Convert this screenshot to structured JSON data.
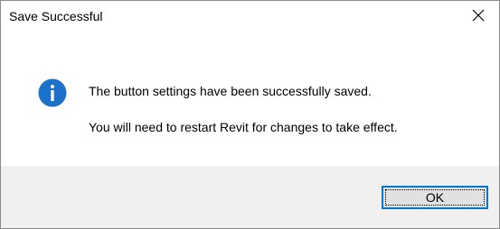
{
  "window": {
    "title": "Save Successful",
    "close_icon": "close-icon"
  },
  "message": {
    "icon": "info-icon",
    "line1": "The button settings have been successfully saved.",
    "line2": "You will need to restart Revit for changes to take effect."
  },
  "buttons": {
    "ok_label": "OK"
  },
  "colors": {
    "accent": "#0078d7",
    "footer_bg": "#f0f0f0",
    "button_bg": "#e1e1e1"
  }
}
